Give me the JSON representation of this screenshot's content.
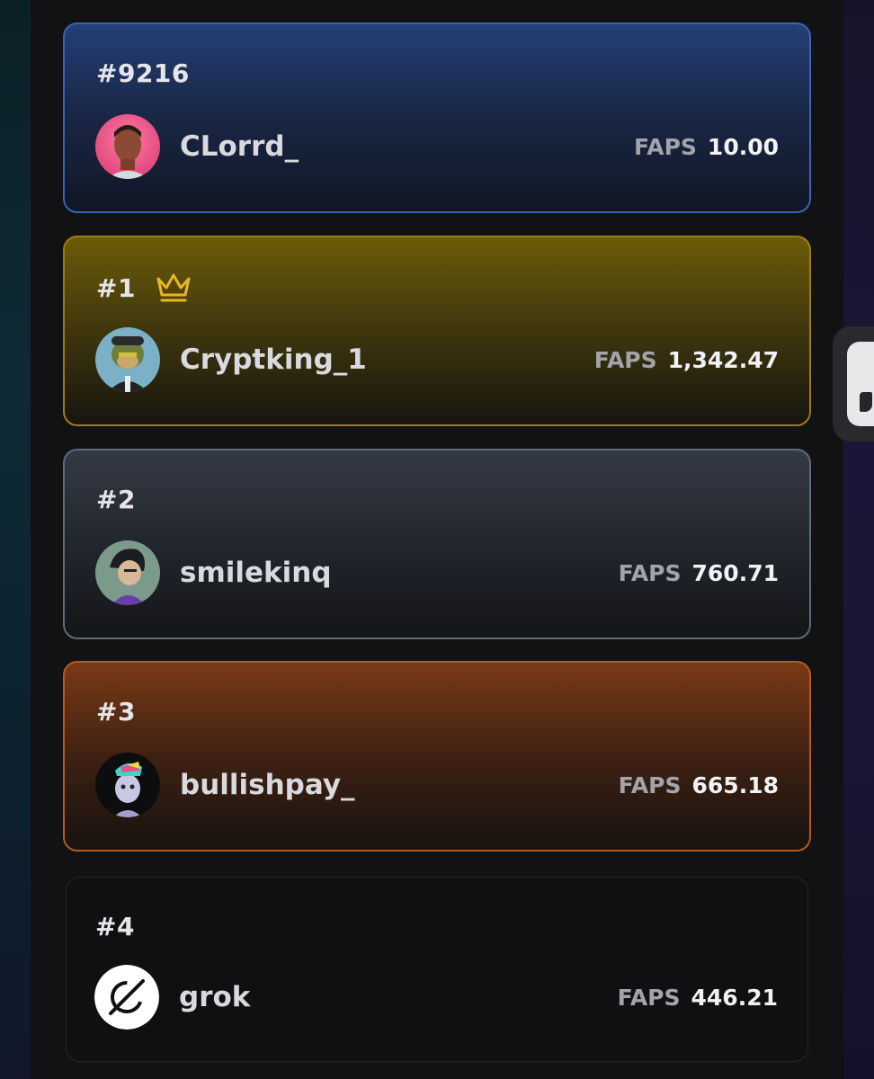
{
  "leaderboard": {
    "score_label": "FAPS",
    "current_user": {
      "rank": "#9216",
      "username": "CLorrd_",
      "score": "10.00",
      "avatar": "avatar-portrait"
    },
    "entries": [
      {
        "rank": "#1",
        "username": "Cryptking_1",
        "score": "1,342.47",
        "badge": "crown-icon",
        "avatar": "avatar-ape"
      },
      {
        "rank": "#2",
        "username": "smilekinq",
        "score": "760.71",
        "avatar": "avatar-cartoon"
      },
      {
        "rank": "#3",
        "username": "bullishpay_",
        "score": "665.18",
        "avatar": "avatar-neon-creature"
      },
      {
        "rank": "#4",
        "username": "grok",
        "score": "446.21",
        "avatar": "grok-logo"
      }
    ]
  },
  "colors": {
    "self_card_border": "#3a64b4",
    "gold_card_border": "#9b7d17",
    "silver_card_border": "#5f6a7a",
    "bronze_card_border": "#b45b1e",
    "crown": "#e7b628"
  }
}
